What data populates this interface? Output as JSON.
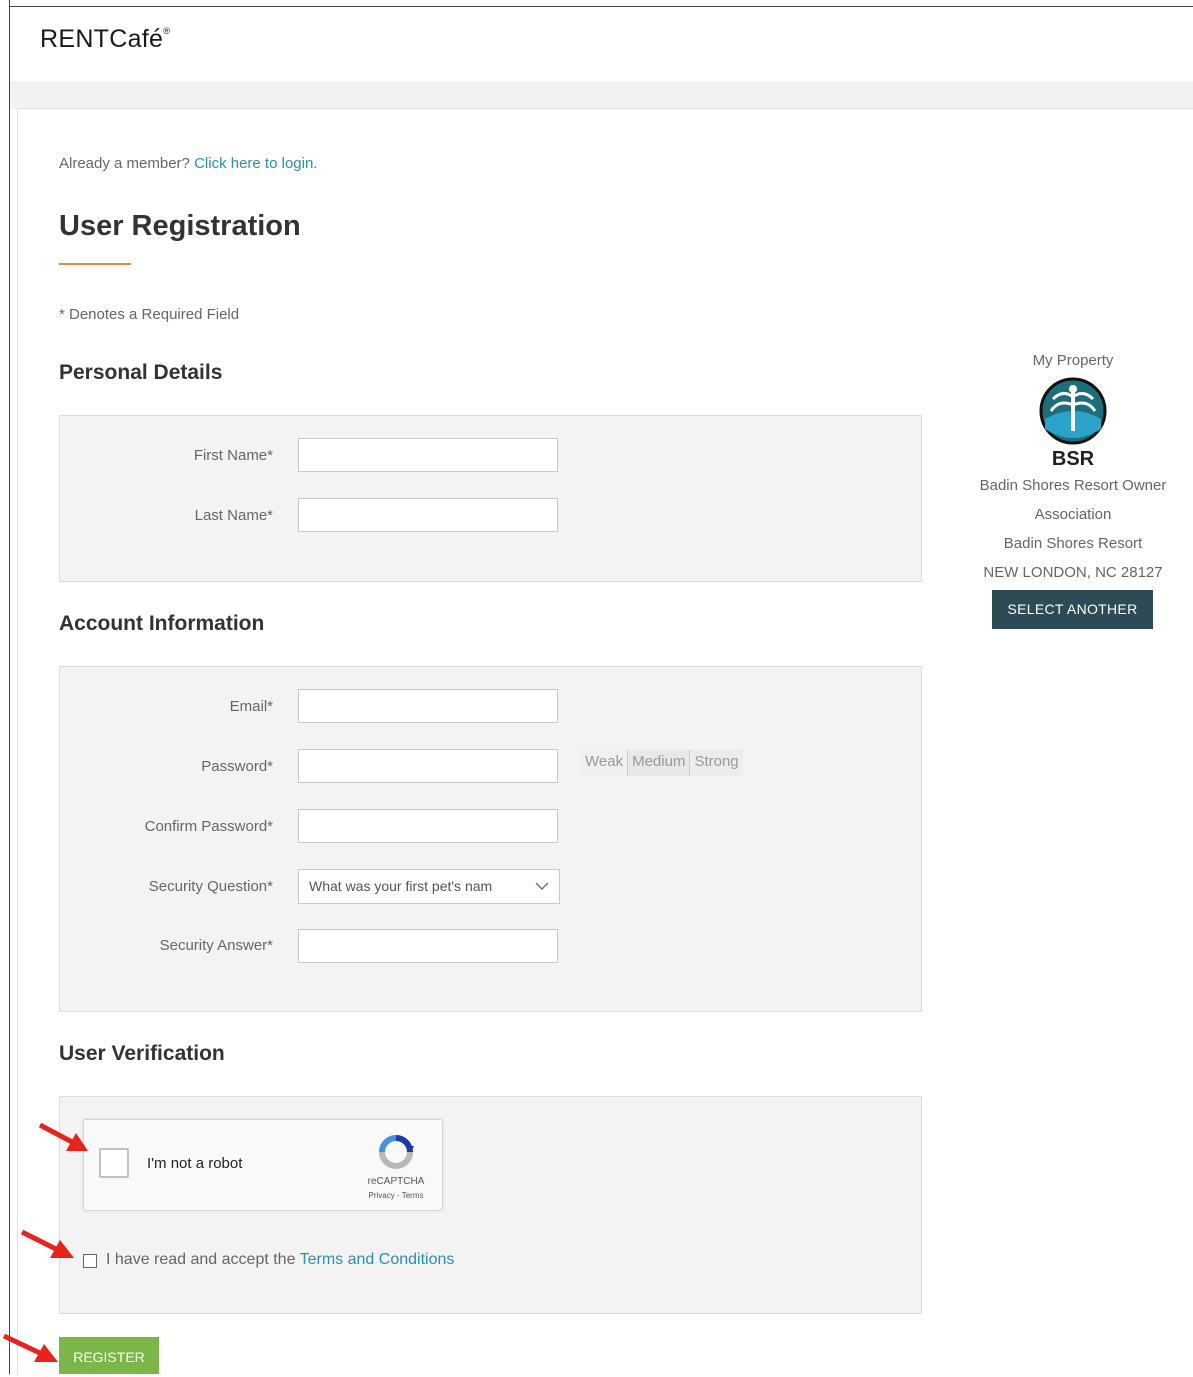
{
  "brand": {
    "name": "RENTCafé",
    "registered": "®"
  },
  "login_prompt": {
    "text": "Already a member?",
    "link": "Click here to login."
  },
  "page_title": "User Registration",
  "required_note": "* Denotes a Required Field",
  "personal_details": {
    "title": "Personal Details",
    "fields": {
      "first_name": "First Name*",
      "last_name": "Last Name*"
    }
  },
  "account_information": {
    "title": "Account Information",
    "fields": {
      "email": "Email*",
      "password": "Password*",
      "confirm_password": "Confirm Password*",
      "security_question": "Security Question*",
      "security_answer": "Security Answer*"
    },
    "security_question_value": "What was your first pet's nam",
    "password_strength": [
      "Weak",
      "Medium",
      "Strong"
    ]
  },
  "user_verification": {
    "title": "User Verification",
    "recaptcha": {
      "label": "I'm not a robot",
      "brand": "reCAPTCHA",
      "links": "Privacy - Terms"
    },
    "terms": {
      "text": "I have read and accept the",
      "link": "Terms and Conditions"
    }
  },
  "register_button": "REGISTER",
  "property": {
    "heading": "My Property",
    "abbrev": "BSR",
    "name_line1": "Badin Shores Resort Owner",
    "name_line2": "Association",
    "community": "Badin Shores Resort",
    "location": "NEW LONDON, NC 28127",
    "button": "SELECT ANOTHER"
  },
  "colors": {
    "accent_link": "#2a8fb0",
    "register_green": "#7ab648",
    "select_button": "#2f4a57",
    "title_rule": "#e08a3c",
    "annotation_arrow": "#e8231b"
  }
}
